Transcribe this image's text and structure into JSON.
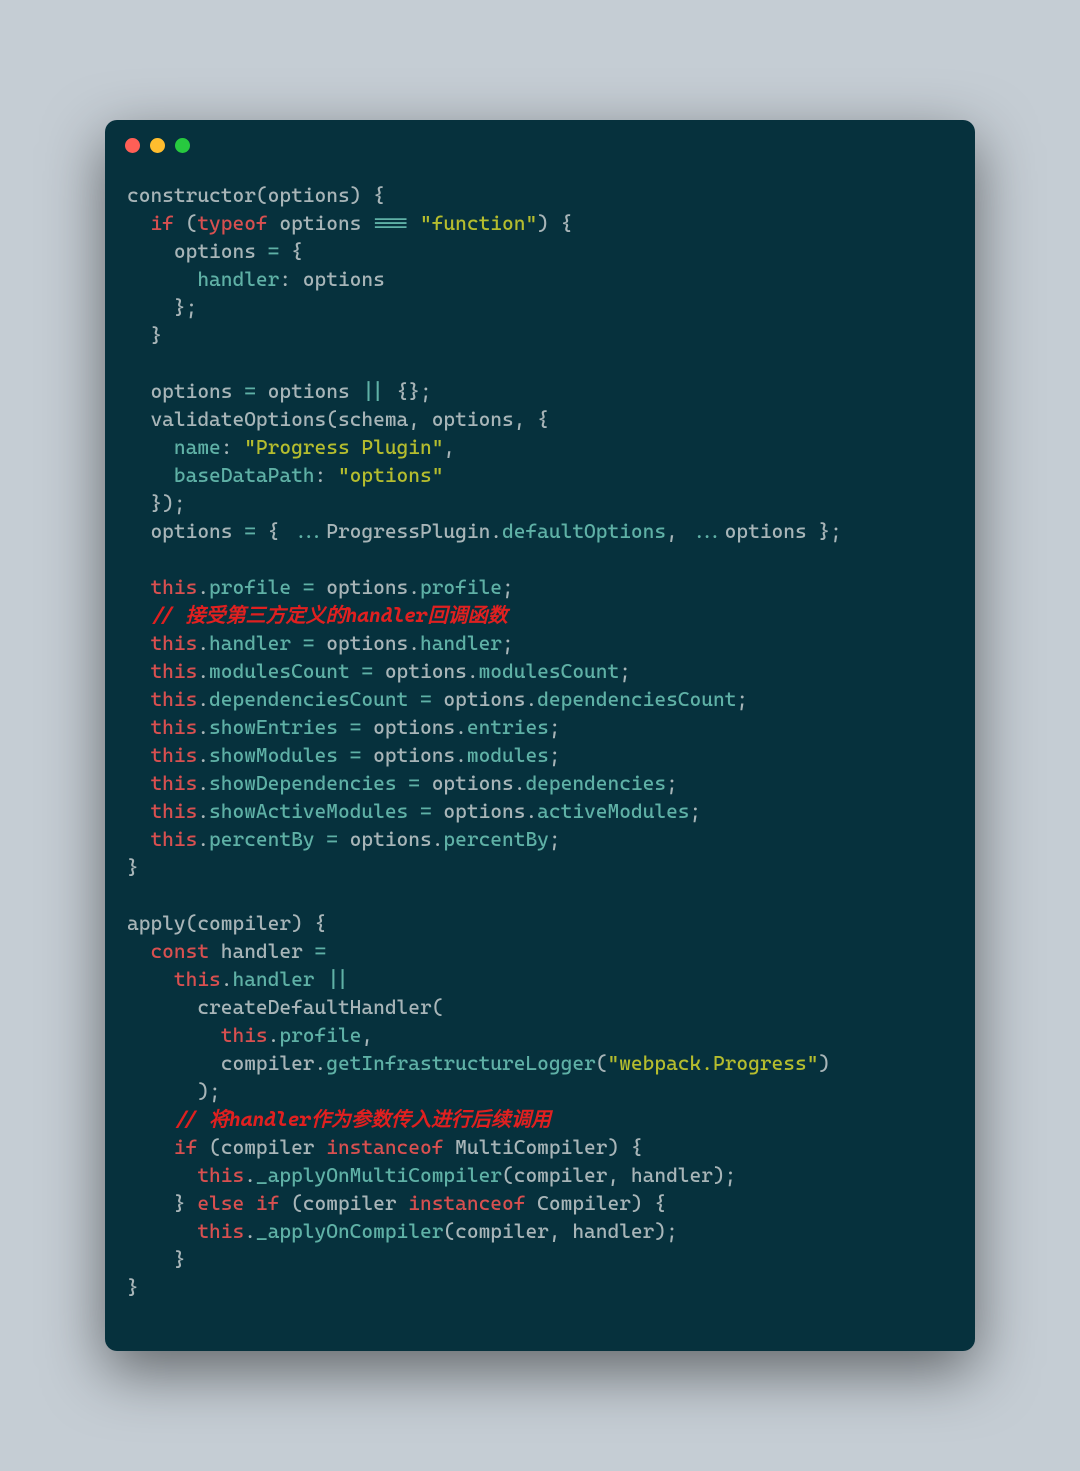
{
  "window": {
    "dots": {
      "red": "#ff5f56",
      "yellow": "#ffbd2e",
      "green": "#27c93f"
    }
  },
  "code": {
    "lines": [
      [
        {
          "t": "constructor",
          "c": "punct"
        },
        {
          "t": "(options) {",
          "c": "punct"
        }
      ],
      [
        {
          "t": "  ",
          "c": ""
        },
        {
          "t": "if",
          "c": "kw"
        },
        {
          "t": " (",
          "c": "punct"
        },
        {
          "t": "typeof",
          "c": "kw"
        },
        {
          "t": " options ",
          "c": "punct"
        },
        {
          "t": "===",
          "c": "op"
        },
        {
          "t": " ",
          "c": ""
        },
        {
          "t": "\"function\"",
          "c": "str"
        },
        {
          "t": ") {",
          "c": "punct"
        }
      ],
      [
        {
          "t": "    options ",
          "c": "punct"
        },
        {
          "t": "=",
          "c": "op"
        },
        {
          "t": " {",
          "c": "punct"
        }
      ],
      [
        {
          "t": "      ",
          "c": ""
        },
        {
          "t": "handler",
          "c": "prop"
        },
        {
          "t": ": options",
          "c": "punct"
        }
      ],
      [
        {
          "t": "    };",
          "c": "punct"
        }
      ],
      [
        {
          "t": "  }",
          "c": "punct"
        }
      ],
      [
        {
          "t": "",
          "c": ""
        }
      ],
      [
        {
          "t": "  options ",
          "c": "punct"
        },
        {
          "t": "=",
          "c": "op"
        },
        {
          "t": " options ",
          "c": "punct"
        },
        {
          "t": "||",
          "c": "op"
        },
        {
          "t": " {};",
          "c": "punct"
        }
      ],
      [
        {
          "t": "  validateOptions(schema, options, {",
          "c": "punct"
        }
      ],
      [
        {
          "t": "    ",
          "c": ""
        },
        {
          "t": "name",
          "c": "prop"
        },
        {
          "t": ": ",
          "c": "punct"
        },
        {
          "t": "\"Progress Plugin\"",
          "c": "str"
        },
        {
          "t": ",",
          "c": "punct"
        }
      ],
      [
        {
          "t": "    ",
          "c": ""
        },
        {
          "t": "baseDataPath",
          "c": "prop"
        },
        {
          "t": ": ",
          "c": "punct"
        },
        {
          "t": "\"options\"",
          "c": "str"
        }
      ],
      [
        {
          "t": "  });",
          "c": "punct"
        }
      ],
      [
        {
          "t": "  options ",
          "c": "punct"
        },
        {
          "t": "=",
          "c": "op"
        },
        {
          "t": " { ",
          "c": "punct"
        },
        {
          "t": "...",
          "c": "op"
        },
        {
          "t": "ProgressPlugin.",
          "c": "punct"
        },
        {
          "t": "defaultOptions",
          "c": "prop"
        },
        {
          "t": ", ",
          "c": "punct"
        },
        {
          "t": "...",
          "c": "op"
        },
        {
          "t": "options };",
          "c": "punct"
        }
      ],
      [
        {
          "t": "",
          "c": ""
        }
      ],
      [
        {
          "t": "  ",
          "c": ""
        },
        {
          "t": "this",
          "c": "kw"
        },
        {
          "t": ".",
          "c": "punct"
        },
        {
          "t": "profile",
          "c": "prop"
        },
        {
          "t": " ",
          "c": ""
        },
        {
          "t": "=",
          "c": "op"
        },
        {
          "t": " options.",
          "c": "punct"
        },
        {
          "t": "profile",
          "c": "prop"
        },
        {
          "t": ";",
          "c": "punct"
        }
      ],
      [
        {
          "t": "  ",
          "c": ""
        },
        {
          "t": "// 接受第三方定义的handler回调函数",
          "c": "comment-red"
        }
      ],
      [
        {
          "t": "  ",
          "c": ""
        },
        {
          "t": "this",
          "c": "kw"
        },
        {
          "t": ".",
          "c": "punct"
        },
        {
          "t": "handler",
          "c": "prop"
        },
        {
          "t": " ",
          "c": ""
        },
        {
          "t": "=",
          "c": "op"
        },
        {
          "t": " options.",
          "c": "punct"
        },
        {
          "t": "handler",
          "c": "prop"
        },
        {
          "t": ";",
          "c": "punct"
        }
      ],
      [
        {
          "t": "  ",
          "c": ""
        },
        {
          "t": "this",
          "c": "kw"
        },
        {
          "t": ".",
          "c": "punct"
        },
        {
          "t": "modulesCount",
          "c": "prop"
        },
        {
          "t": " ",
          "c": ""
        },
        {
          "t": "=",
          "c": "op"
        },
        {
          "t": " options.",
          "c": "punct"
        },
        {
          "t": "modulesCount",
          "c": "prop"
        },
        {
          "t": ";",
          "c": "punct"
        }
      ],
      [
        {
          "t": "  ",
          "c": ""
        },
        {
          "t": "this",
          "c": "kw"
        },
        {
          "t": ".",
          "c": "punct"
        },
        {
          "t": "dependenciesCount",
          "c": "prop"
        },
        {
          "t": " ",
          "c": ""
        },
        {
          "t": "=",
          "c": "op"
        },
        {
          "t": " options.",
          "c": "punct"
        },
        {
          "t": "dependenciesCount",
          "c": "prop"
        },
        {
          "t": ";",
          "c": "punct"
        }
      ],
      [
        {
          "t": "  ",
          "c": ""
        },
        {
          "t": "this",
          "c": "kw"
        },
        {
          "t": ".",
          "c": "punct"
        },
        {
          "t": "showEntries",
          "c": "prop"
        },
        {
          "t": " ",
          "c": ""
        },
        {
          "t": "=",
          "c": "op"
        },
        {
          "t": " options.",
          "c": "punct"
        },
        {
          "t": "entries",
          "c": "prop"
        },
        {
          "t": ";",
          "c": "punct"
        }
      ],
      [
        {
          "t": "  ",
          "c": ""
        },
        {
          "t": "this",
          "c": "kw"
        },
        {
          "t": ".",
          "c": "punct"
        },
        {
          "t": "showModules",
          "c": "prop"
        },
        {
          "t": " ",
          "c": ""
        },
        {
          "t": "=",
          "c": "op"
        },
        {
          "t": " options.",
          "c": "punct"
        },
        {
          "t": "modules",
          "c": "prop"
        },
        {
          "t": ";",
          "c": "punct"
        }
      ],
      [
        {
          "t": "  ",
          "c": ""
        },
        {
          "t": "this",
          "c": "kw"
        },
        {
          "t": ".",
          "c": "punct"
        },
        {
          "t": "showDependencies",
          "c": "prop"
        },
        {
          "t": " ",
          "c": ""
        },
        {
          "t": "=",
          "c": "op"
        },
        {
          "t": " options.",
          "c": "punct"
        },
        {
          "t": "dependencies",
          "c": "prop"
        },
        {
          "t": ";",
          "c": "punct"
        }
      ],
      [
        {
          "t": "  ",
          "c": ""
        },
        {
          "t": "this",
          "c": "kw"
        },
        {
          "t": ".",
          "c": "punct"
        },
        {
          "t": "showActiveModules",
          "c": "prop"
        },
        {
          "t": " ",
          "c": ""
        },
        {
          "t": "=",
          "c": "op"
        },
        {
          "t": " options.",
          "c": "punct"
        },
        {
          "t": "activeModules",
          "c": "prop"
        },
        {
          "t": ";",
          "c": "punct"
        }
      ],
      [
        {
          "t": "  ",
          "c": ""
        },
        {
          "t": "this",
          "c": "kw"
        },
        {
          "t": ".",
          "c": "punct"
        },
        {
          "t": "percentBy",
          "c": "prop"
        },
        {
          "t": " ",
          "c": ""
        },
        {
          "t": "=",
          "c": "op"
        },
        {
          "t": " options.",
          "c": "punct"
        },
        {
          "t": "percentBy",
          "c": "prop"
        },
        {
          "t": ";",
          "c": "punct"
        }
      ],
      [
        {
          "t": "}",
          "c": "punct"
        }
      ],
      [
        {
          "t": "",
          "c": ""
        }
      ],
      [
        {
          "t": "apply(compiler) {",
          "c": "punct"
        }
      ],
      [
        {
          "t": "  ",
          "c": ""
        },
        {
          "t": "const",
          "c": "kw"
        },
        {
          "t": " handler ",
          "c": "punct"
        },
        {
          "t": "=",
          "c": "op"
        }
      ],
      [
        {
          "t": "    ",
          "c": ""
        },
        {
          "t": "this",
          "c": "kw"
        },
        {
          "t": ".",
          "c": "punct"
        },
        {
          "t": "handler",
          "c": "prop"
        },
        {
          "t": " ",
          "c": ""
        },
        {
          "t": "||",
          "c": "op"
        }
      ],
      [
        {
          "t": "      createDefaultHandler(",
          "c": "punct"
        }
      ],
      [
        {
          "t": "        ",
          "c": ""
        },
        {
          "t": "this",
          "c": "kw"
        },
        {
          "t": ".",
          "c": "punct"
        },
        {
          "t": "profile",
          "c": "prop"
        },
        {
          "t": ",",
          "c": "punct"
        }
      ],
      [
        {
          "t": "        compiler.",
          "c": "punct"
        },
        {
          "t": "getInfrastructureLogger",
          "c": "prop"
        },
        {
          "t": "(",
          "c": "punct"
        },
        {
          "t": "\"webpack.Progress\"",
          "c": "str"
        },
        {
          "t": ")",
          "c": "punct"
        }
      ],
      [
        {
          "t": "      );",
          "c": "punct"
        }
      ],
      [
        {
          "t": "    ",
          "c": ""
        },
        {
          "t": "// 将handler作为参数传入进行后续调用",
          "c": "comment-red"
        }
      ],
      [
        {
          "t": "    ",
          "c": ""
        },
        {
          "t": "if",
          "c": "kw"
        },
        {
          "t": " (compiler ",
          "c": "punct"
        },
        {
          "t": "instanceof",
          "c": "kw"
        },
        {
          "t": " MultiCompiler) {",
          "c": "punct"
        }
      ],
      [
        {
          "t": "      ",
          "c": ""
        },
        {
          "t": "this",
          "c": "kw"
        },
        {
          "t": ".",
          "c": "punct"
        },
        {
          "t": "_applyOnMultiCompiler",
          "c": "prop"
        },
        {
          "t": "(compiler, handler);",
          "c": "punct"
        }
      ],
      [
        {
          "t": "    } ",
          "c": "punct"
        },
        {
          "t": "else",
          "c": "kw"
        },
        {
          "t": " ",
          "c": ""
        },
        {
          "t": "if",
          "c": "kw"
        },
        {
          "t": " (compiler ",
          "c": "punct"
        },
        {
          "t": "instanceof",
          "c": "kw"
        },
        {
          "t": " Compiler) {",
          "c": "punct"
        }
      ],
      [
        {
          "t": "      ",
          "c": ""
        },
        {
          "t": "this",
          "c": "kw"
        },
        {
          "t": ".",
          "c": "punct"
        },
        {
          "t": "_applyOnCompiler",
          "c": "prop"
        },
        {
          "t": "(compiler, handler);",
          "c": "punct"
        }
      ],
      [
        {
          "t": "    }",
          "c": "punct"
        }
      ],
      [
        {
          "t": "}",
          "c": "punct"
        }
      ]
    ]
  }
}
